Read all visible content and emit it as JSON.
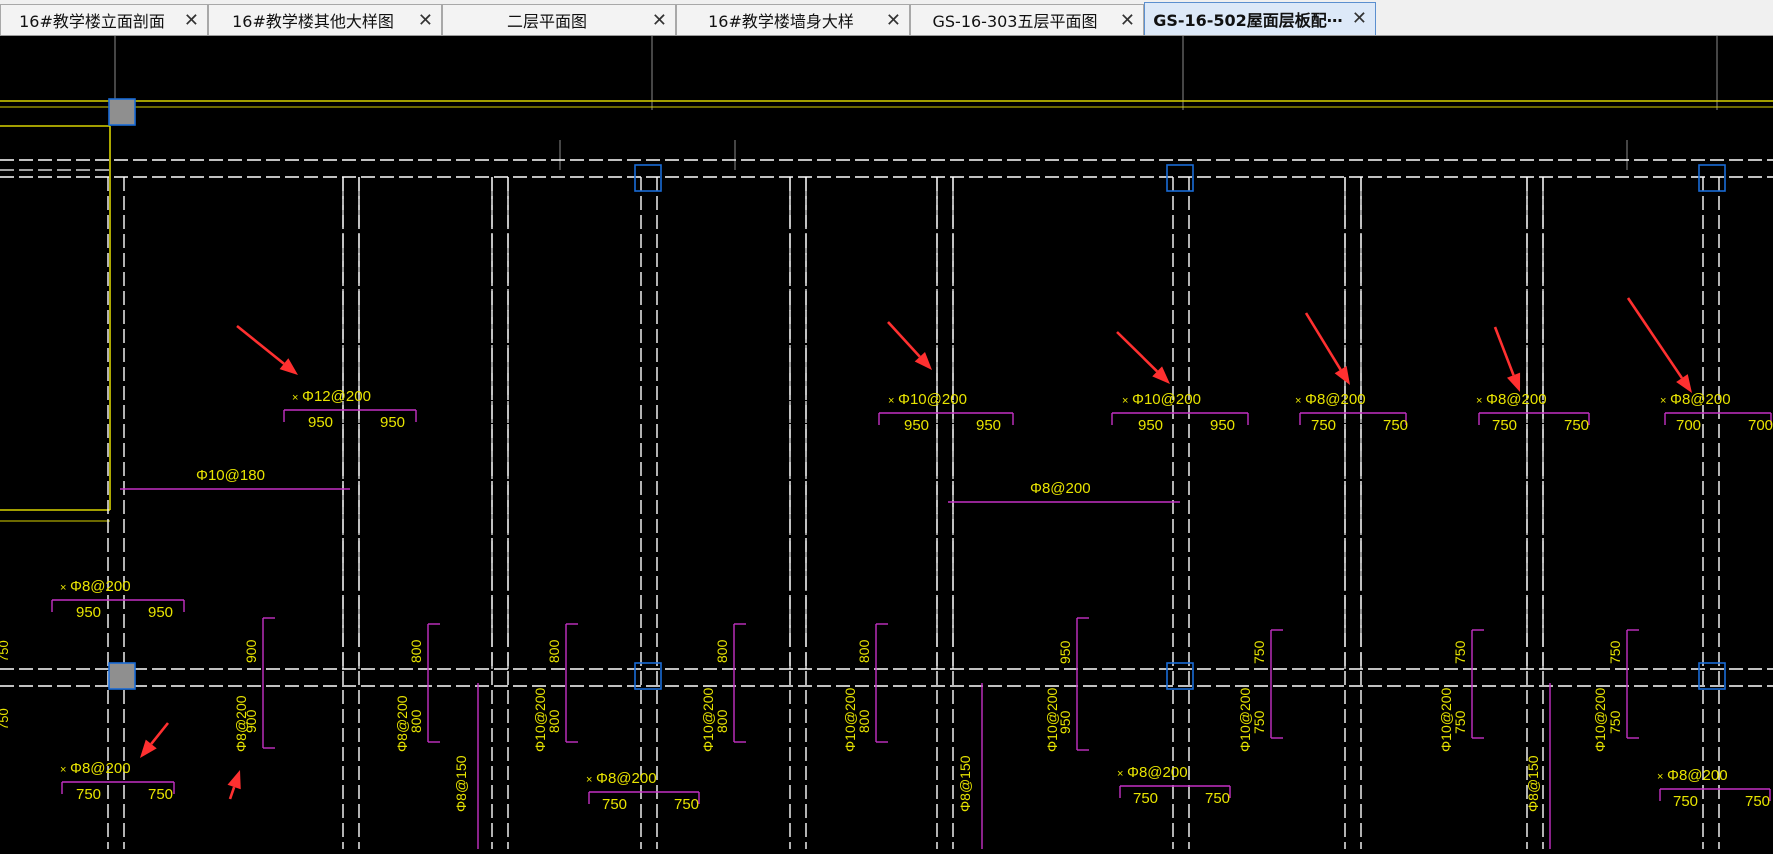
{
  "tabs": [
    {
      "label": "16#教学楼立面剖面",
      "active": false
    },
    {
      "label": "16#教学楼其他大样图",
      "active": false
    },
    {
      "label": "二层平面图",
      "active": false
    },
    {
      "label": "16#教学楼墙身大样",
      "active": false
    },
    {
      "label": "GS-16-303五层平面图",
      "active": false
    },
    {
      "label": "GS-16-502屋面层板配⋯",
      "active": true
    }
  ],
  "close_glyph": "✕",
  "drawing": {
    "colors": {
      "background": "#000000",
      "wall_line": "#ffffff",
      "border_yellow": "#d8d200",
      "rebar_magenta": "#c430c4",
      "label_yellow": "#e8e400",
      "column_blue": "#1a6bd6",
      "arrow_red": "#ff3030",
      "grid_grey": "#8a8a8a"
    },
    "rebar_labels": [
      {
        "text": "Φ12@200"
      },
      {
        "text": "Φ10@200"
      },
      {
        "text": "Φ10@200"
      },
      {
        "text": "Φ8@200"
      },
      {
        "text": "Φ8@200"
      },
      {
        "text": "Φ8@200"
      },
      {
        "text": "Φ10@180"
      },
      {
        "text": "Φ8@200"
      },
      {
        "text": "Φ8@200"
      },
      {
        "text": "Φ8@200"
      },
      {
        "text": "Φ8@200"
      },
      {
        "text": "Φ8@200"
      },
      {
        "text": "Φ8@200"
      },
      {
        "text": "Φ10@200"
      },
      {
        "text": "Φ8@200"
      },
      {
        "text": "Φ10@200"
      },
      {
        "text": "Φ8@150"
      },
      {
        "text": "Φ10@200"
      },
      {
        "text": "Φ8@200"
      },
      {
        "text": "Φ8@150"
      },
      {
        "text": "Φ10@200"
      },
      {
        "text": "Φ10@200"
      },
      {
        "text": "Φ10@200"
      },
      {
        "text": "Φ8@150"
      },
      {
        "text": "Φ10@200"
      }
    ],
    "dimension_pairs": [
      [
        "950",
        "950"
      ],
      [
        "950",
        "950"
      ],
      [
        "950",
        "950"
      ],
      [
        "750",
        "750"
      ],
      [
        "750",
        "750"
      ],
      [
        "700",
        "700"
      ],
      [
        "950",
        "950"
      ],
      [
        "750",
        "750"
      ],
      [
        "750",
        "750"
      ],
      [
        "750",
        "750"
      ],
      [
        "750",
        "750"
      ]
    ],
    "vertical_dims": [
      [
        "900",
        "900"
      ],
      [
        "800",
        "800"
      ],
      [
        "800",
        "800"
      ],
      [
        "800",
        "800"
      ],
      [
        "800",
        "800"
      ],
      [
        "950",
        "950"
      ],
      [
        "750",
        "750"
      ],
      [
        "750",
        "750"
      ],
      [
        "750",
        "750"
      ]
    ],
    "edge_dims": [
      "750",
      "750"
    ]
  }
}
